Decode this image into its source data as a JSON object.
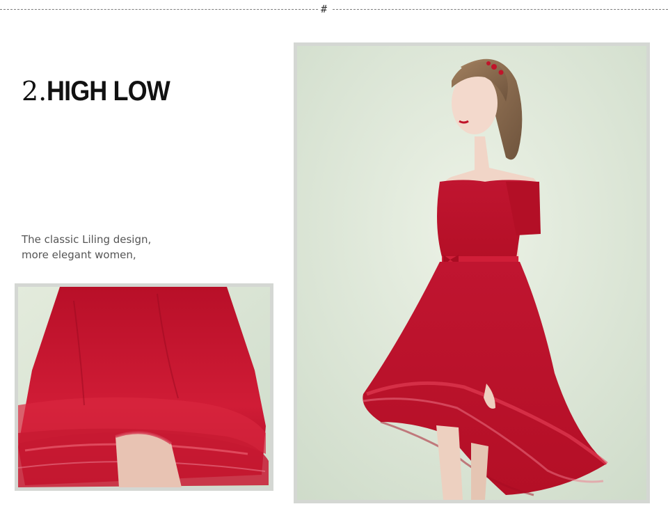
{
  "header": {
    "separator_glyph": "#"
  },
  "section": {
    "number": "2.",
    "title": "HIGH LOW",
    "description_lines": [
      "The classic Liling design,",
      "more elegant women,"
    ]
  },
  "images": {
    "detail_photo": {
      "subject": "red tulle high-low skirt close-up"
    },
    "main_photo": {
      "subject": "model in red off-shoulder high-low tulle dress"
    }
  },
  "colors": {
    "dress_red": "#c0142a",
    "background_mint": "#dfe8d8",
    "frame_gray": "#d4d7d3",
    "title_text": "#111111",
    "body_text": "#555555"
  }
}
